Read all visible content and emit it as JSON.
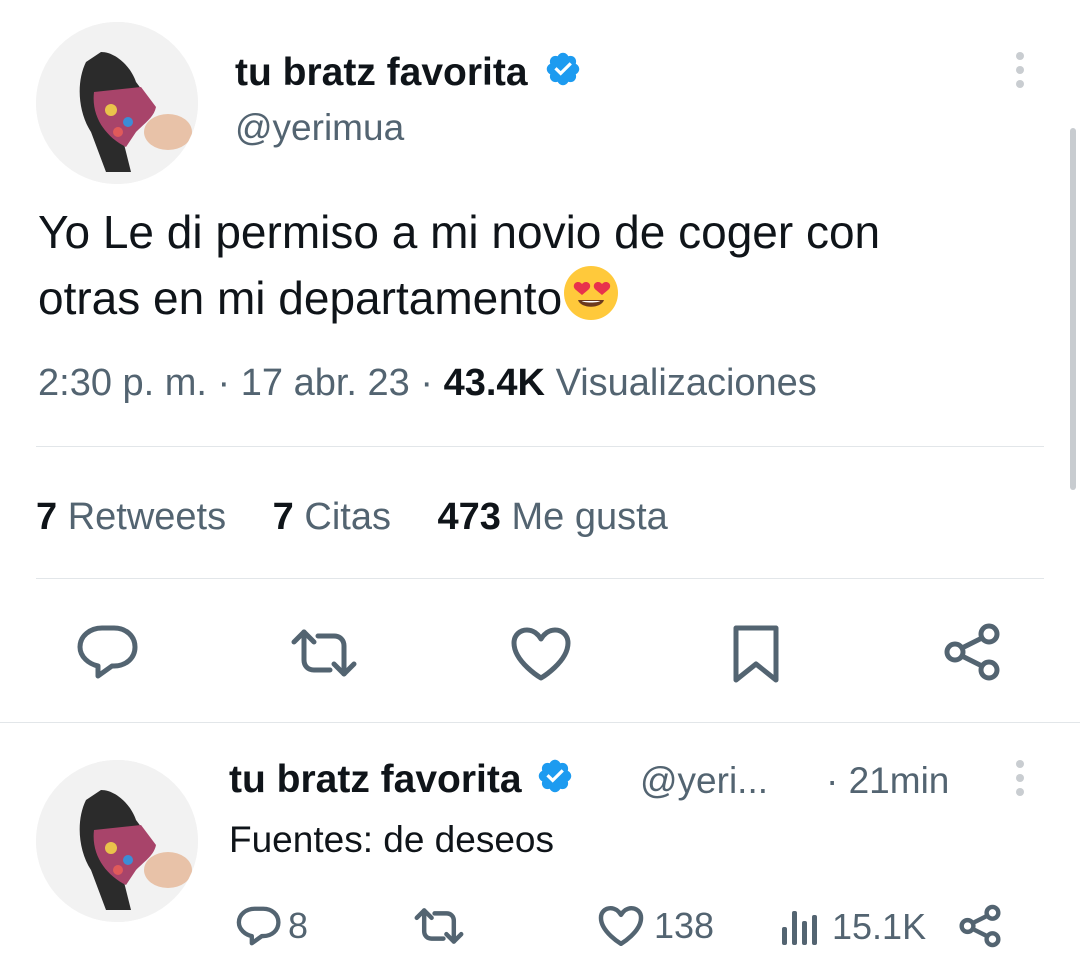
{
  "main_tweet": {
    "display_name": "tu bratz favorita",
    "handle": "@yerimua",
    "text_line1": "Yo Le di permiso a mi novio de coger con",
    "text_line2": "otras en mi departamento",
    "emoji": "😍",
    "time": "2:30 p. m.",
    "separator": "·",
    "date": "17 abr. 23",
    "views_count": "43.4K",
    "views_label": "Visualizaciones",
    "retweets_count": "7",
    "retweets_label": "Retweets",
    "quotes_count": "7",
    "quotes_label": "Citas",
    "likes_count": "473",
    "likes_label": "Me gusta"
  },
  "reply": {
    "display_name": "tu bratz favorita",
    "handle": "@yeri...",
    "time": "· 21min",
    "text": "Fuentes: de deseos",
    "replies": "8",
    "likes": "138",
    "views": "15.1K"
  },
  "icons": {
    "verified": "verified-badge-icon",
    "more": "more-vertical-icon",
    "reply": "reply-icon",
    "retweet": "retweet-icon",
    "like": "heart-icon",
    "bookmark": "bookmark-icon",
    "share": "share-icon",
    "views": "views-bar-icon"
  },
  "colors": {
    "verified": "#1d9bf0",
    "text_primary": "#0f1419",
    "text_secondary": "#536471",
    "divider": "#e2e6e9"
  }
}
